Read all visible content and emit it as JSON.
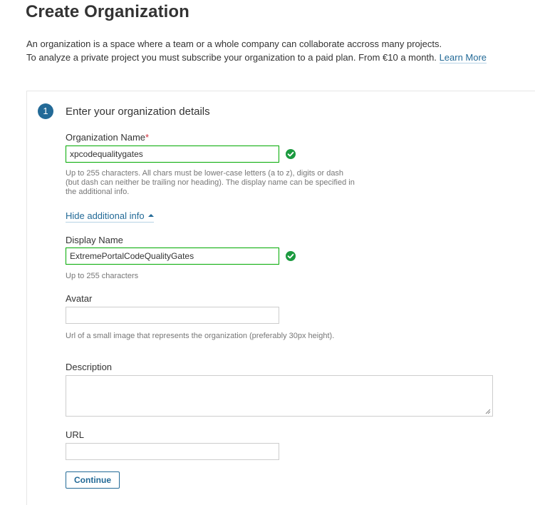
{
  "page": {
    "title": "Create Organization",
    "intro_line1": "An organization is a space where a team or a whole company can collaborate accross many projects.",
    "intro_line2": "To analyze a private project you must subscribe your organization to a paid plan. From €10 a month.",
    "learn_more_label": "Learn More"
  },
  "step": {
    "number": "1",
    "title": "Enter your organization details"
  },
  "form": {
    "org_name": {
      "label": "Organization Name",
      "required_marker": "*",
      "value": "xpcodequalitygates",
      "valid": true,
      "hint": "Up to 255 characters. All chars must be lower-case letters (a to z), digits or dash (but dash can neither be trailing nor heading). The display name can be specified in the additional info."
    },
    "toggle_label": "Hide additional info",
    "display_name": {
      "label": "Display Name",
      "value": "ExtremePortalCodeQualityGates",
      "valid": true,
      "hint": "Up to 255 characters"
    },
    "avatar": {
      "label": "Avatar",
      "value": "",
      "hint": "Url of a small image that represents the organization (preferably 30px height)."
    },
    "description": {
      "label": "Description",
      "value": ""
    },
    "url": {
      "label": "URL",
      "value": ""
    },
    "continue_label": "Continue"
  },
  "colors": {
    "accent": "#236a97",
    "valid": "#00aa00",
    "check_fill": "#1b9a3f",
    "required": "#d02f3a",
    "hint_text": "#777777"
  },
  "icons": {
    "valid_indicator": "check-circle-icon",
    "toggle_indicator": "caret-up-icon",
    "textarea_grip": "resize-grip-icon"
  }
}
